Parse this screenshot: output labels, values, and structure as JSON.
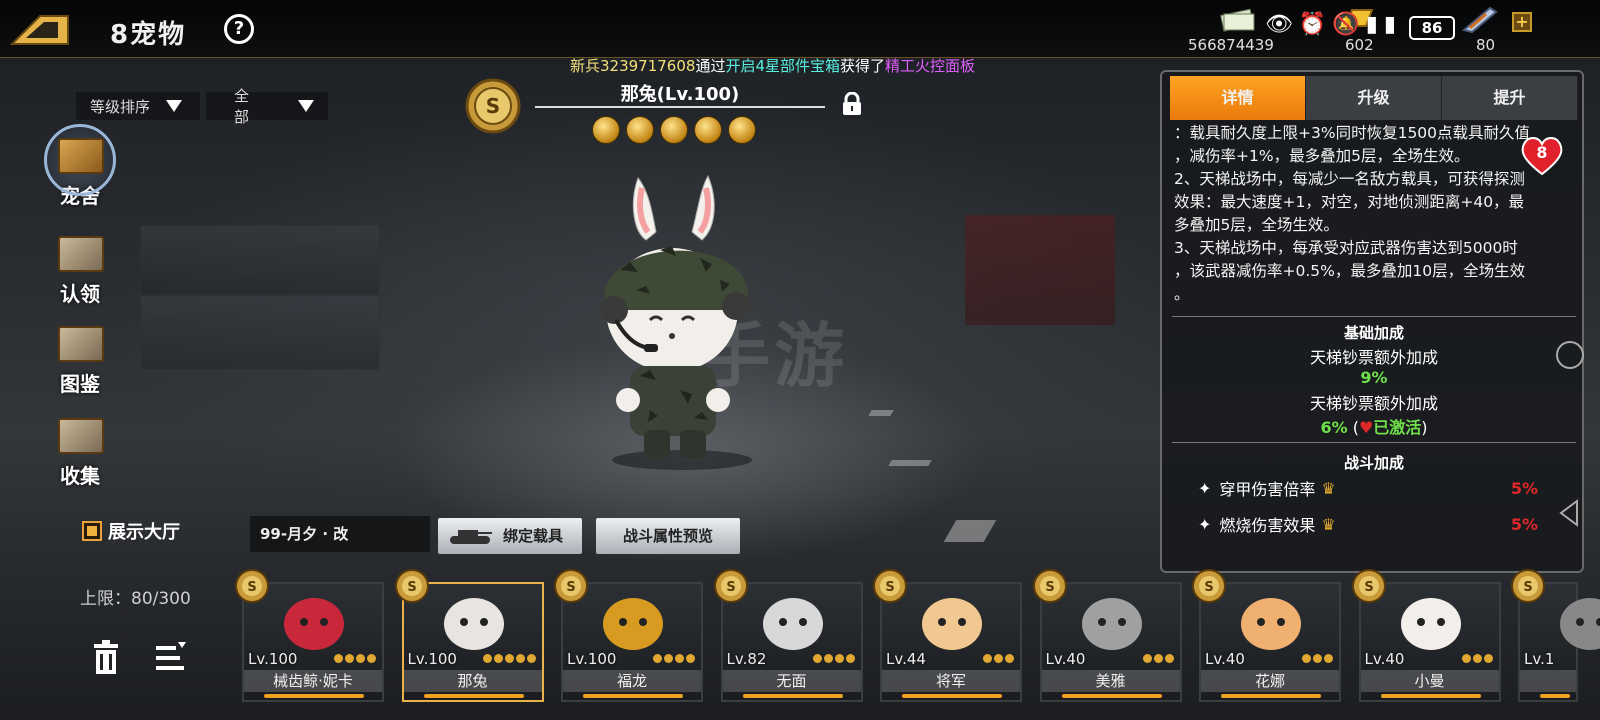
{
  "header": {
    "title": "宠物",
    "title_prefix": "8",
    "help": "?"
  },
  "resources": [
    {
      "name": "cash-icon",
      "value": "566874439"
    },
    {
      "name": "gold-icon",
      "value": "602"
    },
    {
      "name": "wing-icon",
      "value": "80"
    }
  ],
  "status_bar": {
    "battery": "86"
  },
  "ticker": {
    "prefix": "新兵3239717608",
    "mid1": "通过",
    "item1": "开启4星部件宝箱",
    "mid2": "获得了",
    "item2": "精工火控面板"
  },
  "filters": {
    "sort": "等级排序",
    "category": "全部"
  },
  "side_menu": [
    {
      "label": "宠舍",
      "active": true
    },
    {
      "label": "认领",
      "active": false
    },
    {
      "label": "图鉴",
      "active": false
    },
    {
      "label": "收集",
      "active": false
    }
  ],
  "showcase": {
    "label": "展示大厅"
  },
  "capacity": {
    "text": "上限：80/300"
  },
  "pet": {
    "name": "那兔(Lv.100)",
    "stars": 5
  },
  "weapon": {
    "name": "99-月夕 · 改"
  },
  "buttons": {
    "bind_vehicle": "绑定载具",
    "preview": "战斗属性预览"
  },
  "panel": {
    "tabs": [
      "详情",
      "升级",
      "提升"
    ],
    "active_tab": 0,
    "desc": [
      "：载具耐久度上限+3%同时恢复1500点载具耐久值",
      "，减伤率+1%，最多叠加5层，全场生效。",
      "2、天梯战场中，每减少一名敌方载具，可获得探测",
      "效果：最大速度+1，对空，对地侦测距离+40，最",
      "多叠加5层，全场生效。",
      "3、天梯战场中，每承受对应武器伤害达到5000时",
      "，该武器减伤率+0.5%，最多叠加10层，全场生效",
      "。"
    ],
    "base_title": "基础加成",
    "base_line1": "天梯钞票额外加成",
    "base_val1": "9%",
    "base_line2": "天梯钞票额外加成",
    "base_val2": "6%",
    "base_val2_note": "已激活",
    "combat_title": "战斗加成",
    "combat": [
      {
        "label": "穿甲伤害倍率",
        "value": "5%"
      },
      {
        "label": "燃烧伤害效果",
        "value": "5%"
      }
    ],
    "heart_count": "8"
  },
  "cards": [
    {
      "level": "Lv.100",
      "name": "械齿鲸·妮卡",
      "stars": 4,
      "selected": false
    },
    {
      "level": "Lv.100",
      "name": "那兔",
      "stars": 5,
      "selected": true
    },
    {
      "level": "Lv.100",
      "name": "福龙",
      "stars": 4,
      "selected": false
    },
    {
      "level": "Lv.82",
      "name": "无面",
      "stars": 4,
      "selected": false
    },
    {
      "level": "Lv.44",
      "name": "将军",
      "stars": 3,
      "selected": false
    },
    {
      "level": "Lv.40",
      "name": "美雅",
      "stars": 3,
      "selected": false
    },
    {
      "level": "Lv.40",
      "name": "花娜",
      "stars": 3,
      "selected": false
    },
    {
      "level": "Lv.40",
      "name": "小曼",
      "stars": 3,
      "selected": false
    },
    {
      "level": "Lv.1",
      "name": "",
      "stars": 0,
      "selected": false
    }
  ],
  "colors": {
    "accent": "#ea7a0a",
    "gold": "#e0a830",
    "positive": "#6fe04a",
    "negative": "#e02828"
  }
}
